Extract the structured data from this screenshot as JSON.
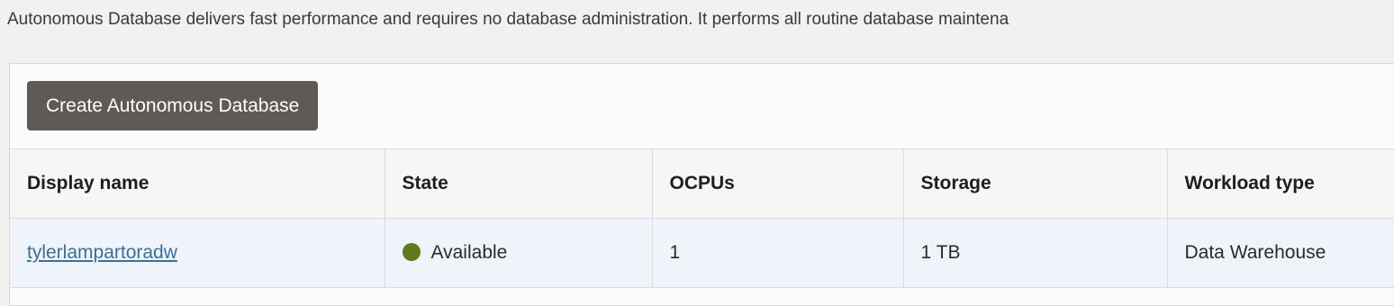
{
  "intro": {
    "text": "Autonomous Database delivers fast performance and requires no database administration. It performs all routine database maintena"
  },
  "toolbar": {
    "create_label": "Create Autonomous Database"
  },
  "table": {
    "columns": [
      "Display name",
      "State",
      "OCPUs",
      "Storage",
      "Workload type"
    ],
    "rows": [
      {
        "display_name": "tylerlampartoradw",
        "state": "Available",
        "state_color": "#5d7a1f",
        "ocpus": "1",
        "storage": "1 TB",
        "workload_type": "Data Warehouse"
      }
    ]
  },
  "colors": {
    "button_bg": "#5e5a56",
    "link": "#3b6f9a",
    "available": "#5d7a1f"
  }
}
